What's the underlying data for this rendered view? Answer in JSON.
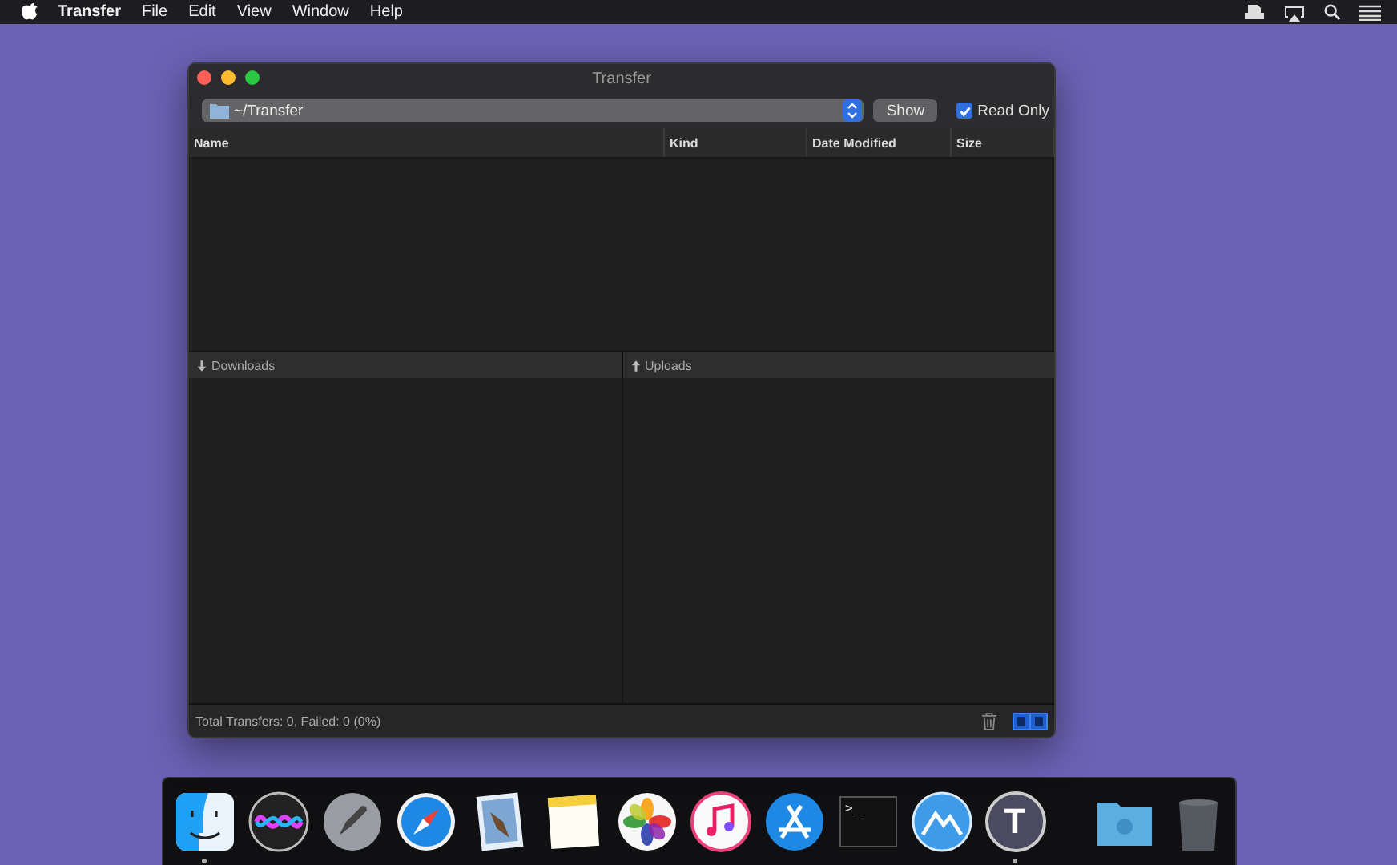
{
  "menu_bar": {
    "app_name": "Transfer",
    "menus": [
      "File",
      "Edit",
      "View",
      "Window",
      "Help"
    ]
  },
  "window": {
    "title": "Transfer",
    "path": "~/Transfer",
    "show_button": "Show",
    "read_only": {
      "label": "Read Only",
      "checked": true
    },
    "columns": [
      "Name",
      "Kind",
      "Date Modified",
      "Size"
    ],
    "panes": [
      {
        "kind": "download",
        "title": "Downloads"
      },
      {
        "kind": "upload",
        "title": "Uploads"
      }
    ],
    "status": "Total Transfers: 0, Failed: 0 (0%)"
  },
  "dock": {
    "apps": [
      {
        "kind": "finder",
        "running": true
      },
      {
        "kind": "siri",
        "running": false
      },
      {
        "kind": "launchpad",
        "running": false
      },
      {
        "kind": "safari",
        "running": false
      },
      {
        "kind": "mail",
        "running": false
      },
      {
        "kind": "notes",
        "running": false
      },
      {
        "kind": "photos",
        "running": false
      },
      {
        "kind": "music",
        "running": false
      },
      {
        "kind": "appstore",
        "running": false
      },
      {
        "kind": "terminal",
        "label": ">_",
        "running": false
      },
      {
        "kind": "mountains",
        "running": false
      },
      {
        "kind": "transfer",
        "label": "T",
        "running": true
      }
    ],
    "stacks": [
      {
        "kind": "downloads-folder"
      },
      {
        "kind": "trash"
      }
    ]
  }
}
